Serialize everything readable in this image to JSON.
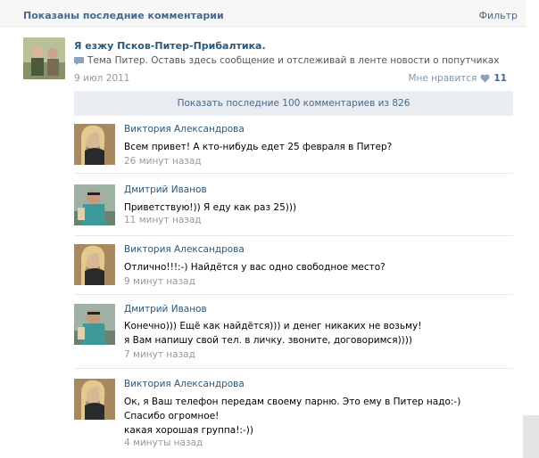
{
  "header": {
    "title": "Показаны последние комментарии",
    "filter": "Фильтр"
  },
  "post": {
    "title": "Я езжу Псков-Питер-Прибалтика.",
    "topic": "Тема Питер. Оставь здесь сообщение и отслеживай в ленте новости о попутчиках",
    "date": "9 июл 2011",
    "like_label": "Мне нравится",
    "like_count": "11"
  },
  "show_more": "Показать последние 100 комментариев из 826",
  "comments": [
    {
      "name": "Виктория Александрова",
      "lines": [
        "Всем привет! А кто-нибудь едет 25 февраля в Питер?"
      ],
      "time": "26 минут назад",
      "avatar": "female"
    },
    {
      "name": "Дмитрий Иванов",
      "lines": [
        "Приветствую!)) Я еду как раз 25)))"
      ],
      "time": "11 минут назад",
      "avatar": "male"
    },
    {
      "name": "Виктория Александрова",
      "lines": [
        "Отлично!!!:-) Найдётся у вас одно свободное место?"
      ],
      "time": "9 минут назад",
      "avatar": "female"
    },
    {
      "name": "Дмитрий Иванов",
      "lines": [
        "Конечно))) Ещё как найдётся))) и денег никаких не возьму!",
        "я Вам напишу свой тел. в личку. звоните, договоримся))))"
      ],
      "time": "7 минут назад",
      "avatar": "male"
    },
    {
      "name": "Виктория Александрова",
      "lines": [
        "Ок, я Ваш телефон передам своему парню. Это ему в Питер надо:-)",
        "Спасибо огромное!",
        "какая хорошая группа!:-))"
      ],
      "time": "4 минуты назад",
      "avatar": "female"
    }
  ],
  "colors": {
    "link": "#2b587a",
    "accent": "#45688e",
    "muted": "#999999",
    "bar": "#e9edf1"
  }
}
